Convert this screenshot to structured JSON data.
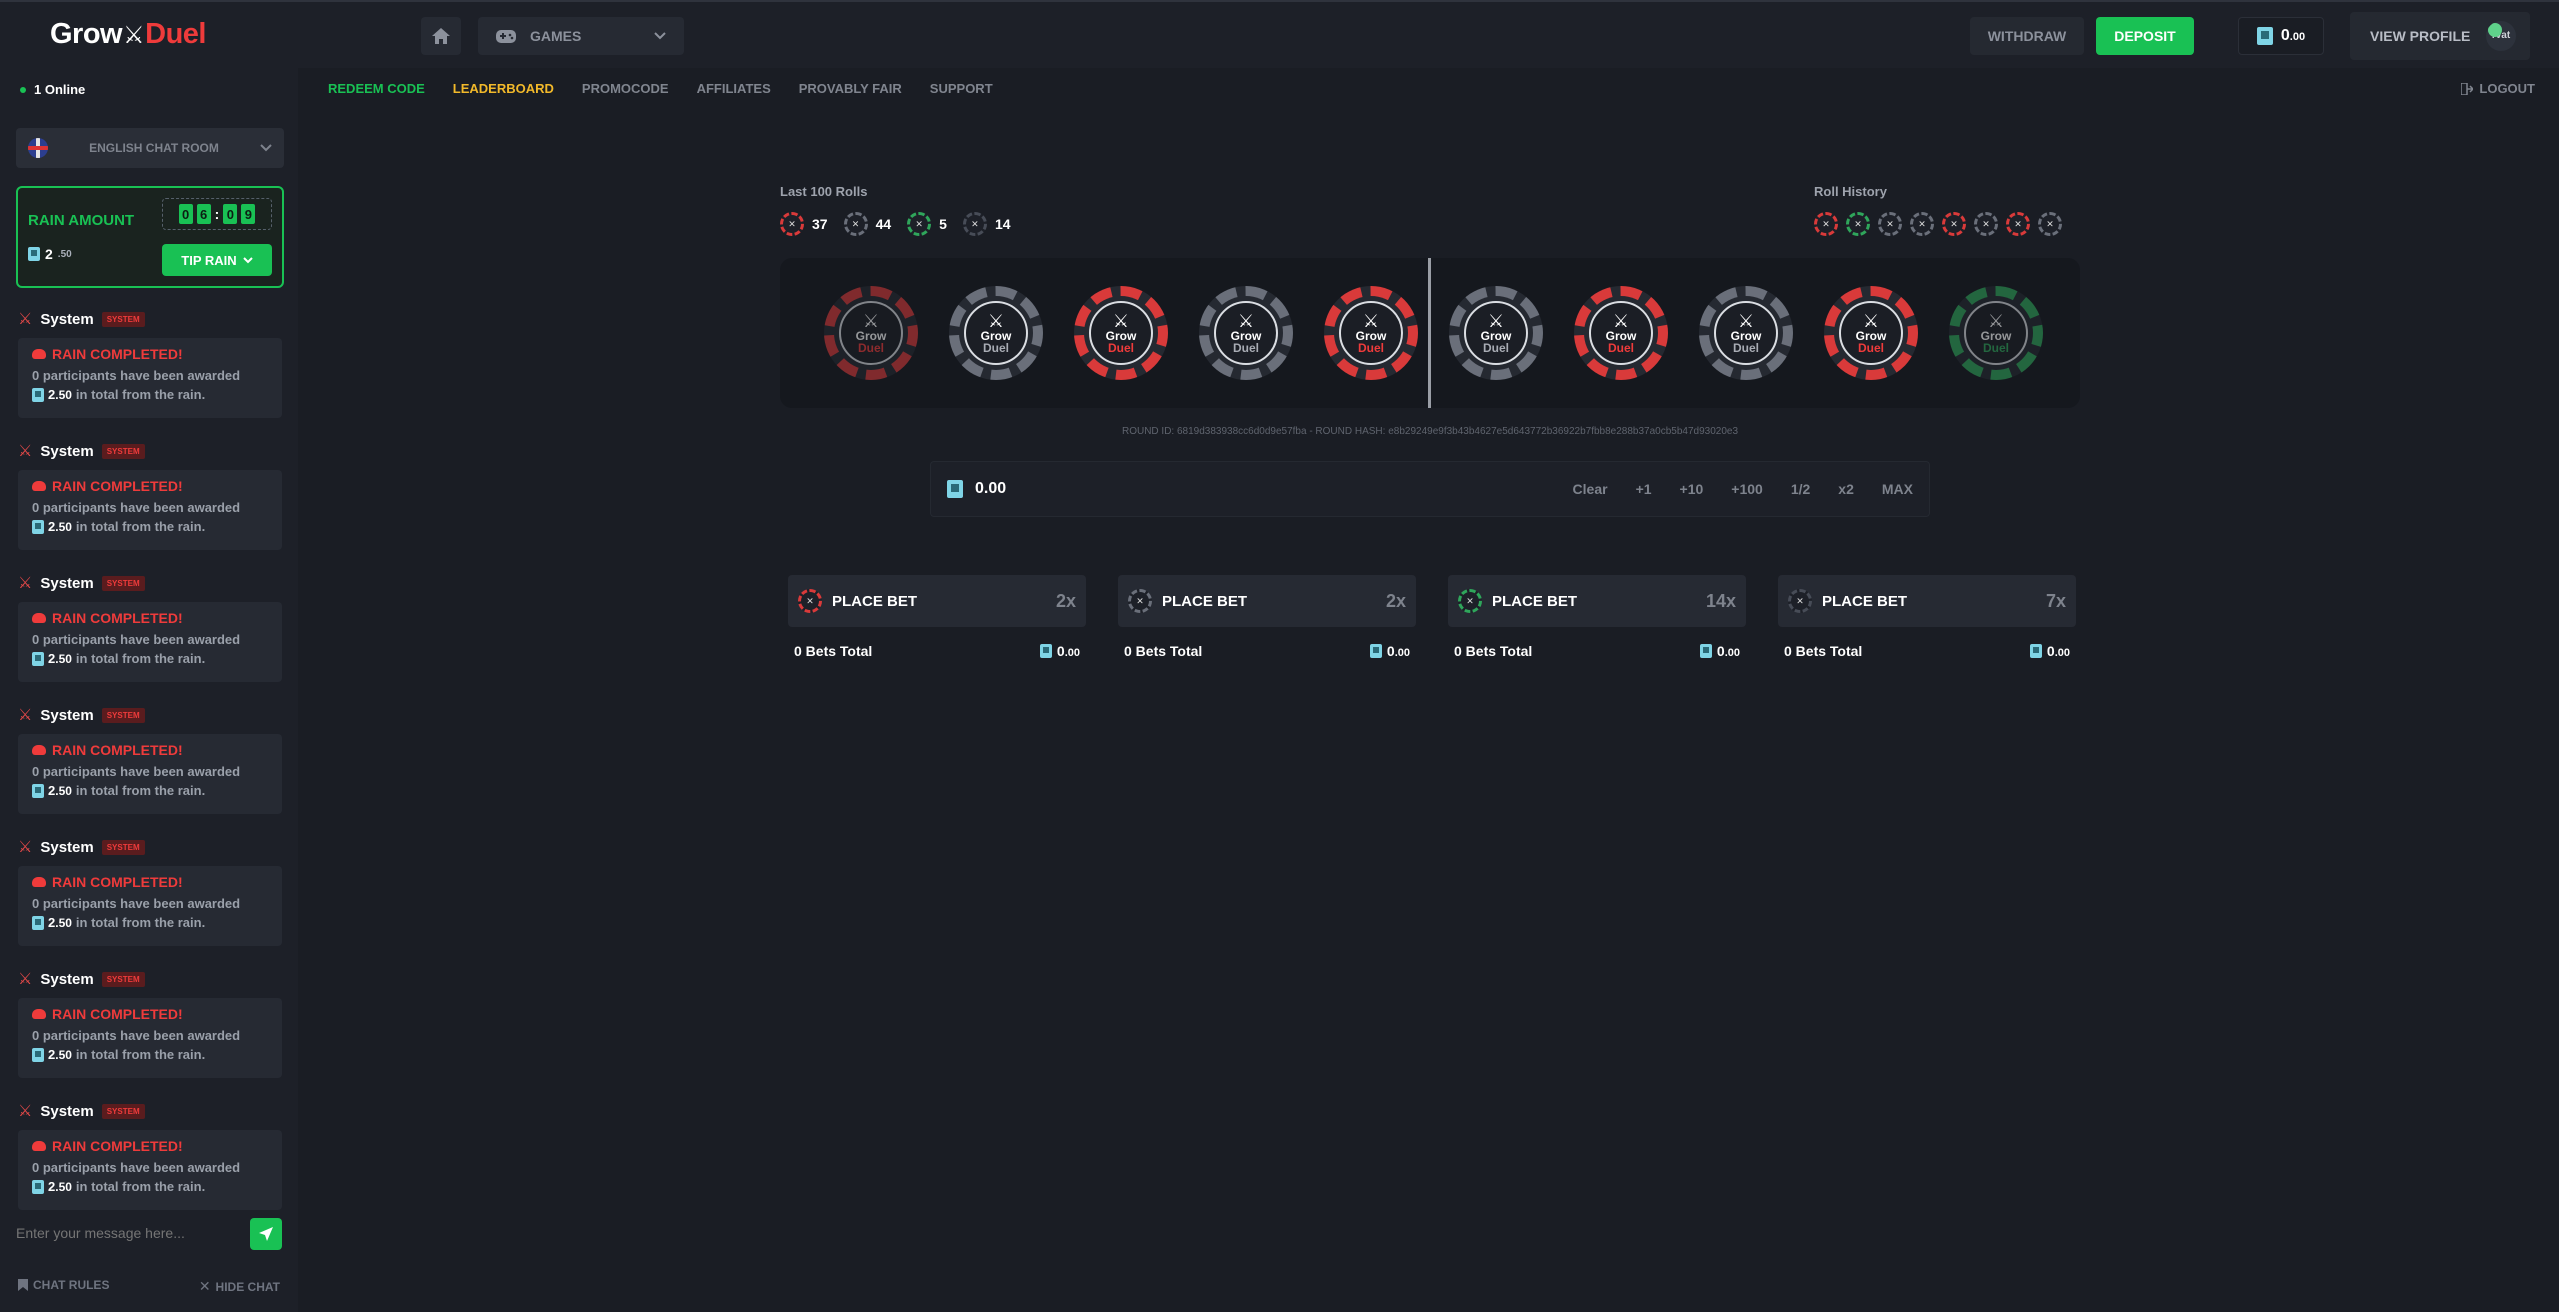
{
  "brand": {
    "logo_left": "Grow",
    "logo_right": "Duel"
  },
  "header": {
    "games_label": "GAMES",
    "withdraw_label": "WITHDRAW",
    "deposit_label": "DEPOSIT",
    "balance_int": "0",
    "balance_dec": ".00",
    "profile_label": "VIEW PROFILE",
    "avatar_alt": "rvat"
  },
  "online": {
    "text": "1 Online"
  },
  "nav": {
    "items": [
      "REDEEM CODE",
      "LEADERBOARD",
      "PROMOCODE",
      "AFFILIATES",
      "PROVABLY FAIR",
      "SUPPORT"
    ],
    "logout_label": "LOGOUT"
  },
  "chat": {
    "room_label": "ENGLISH CHAT ROOM",
    "rain": {
      "title": "RAIN AMOUNT",
      "amount_int": "2",
      "amount_dec": ".50",
      "timer_digits": [
        "0",
        "6",
        "0",
        "9"
      ],
      "tip_label": "TIP RAIN"
    },
    "messages": [
      {
        "name": "System",
        "badge": "SYSTEM",
        "title": "RAIN COMPLETED!",
        "count": "0",
        "line1_rest": "participants have been awarded",
        "amount_int": "2",
        "amount_dec": ".50",
        "line2_rest": "in total from the rain."
      },
      {
        "name": "System",
        "badge": "SYSTEM",
        "title": "RAIN COMPLETED!",
        "count": "0",
        "line1_rest": "participants have been awarded",
        "amount_int": "2",
        "amount_dec": ".50",
        "line2_rest": "in total from the rain."
      },
      {
        "name": "System",
        "badge": "SYSTEM",
        "title": "RAIN COMPLETED!",
        "count": "0",
        "line1_rest": "participants have been awarded",
        "amount_int": "2",
        "amount_dec": ".50",
        "line2_rest": "in total from the rain."
      },
      {
        "name": "System",
        "badge": "SYSTEM",
        "title": "RAIN COMPLETED!",
        "count": "0",
        "line1_rest": "participants have been awarded",
        "amount_int": "2",
        "amount_dec": ".50",
        "line2_rest": "in total from the rain."
      },
      {
        "name": "System",
        "badge": "SYSTEM",
        "title": "RAIN COMPLETED!",
        "count": "0",
        "line1_rest": "participants have been awarded",
        "amount_int": "2",
        "amount_dec": ".50",
        "line2_rest": "in total from the rain."
      },
      {
        "name": "System",
        "badge": "SYSTEM",
        "title": "RAIN COMPLETED!",
        "count": "0",
        "line1_rest": "participants have been awarded",
        "amount_int": "2",
        "amount_dec": ".50",
        "line2_rest": "in total from the rain."
      },
      {
        "name": "System",
        "badge": "SYSTEM",
        "title": "RAIN COMPLETED!",
        "count": "0",
        "line1_rest": "participants have been awarded",
        "amount_int": "2",
        "amount_dec": ".50",
        "line2_rest": "in total from the rain."
      }
    ],
    "input_placeholder": "Enter your message here...",
    "rules_label": "CHAT RULES",
    "hide_label": "HIDE CHAT"
  },
  "game": {
    "last_rolls_label": "Last 100 Rolls",
    "last_rolls": [
      {
        "color": "red",
        "count": "37"
      },
      {
        "color": "grey",
        "count": "44"
      },
      {
        "color": "green",
        "count": "5"
      },
      {
        "color": "dark",
        "count": "14"
      }
    ],
    "history_label": "Roll History",
    "history": [
      "red",
      "green",
      "grey",
      "grey",
      "red",
      "grey",
      "red",
      "grey"
    ],
    "roller_chips": [
      {
        "color": "red",
        "word1": "Grow",
        "word2": "Duel",
        "faded": true
      },
      {
        "color": "grey",
        "word1": "Grow",
        "word2": "Duel",
        "faded": false
      },
      {
        "color": "red",
        "word1": "Grow",
        "word2": "Duel",
        "faded": false
      },
      {
        "color": "grey",
        "word1": "Grow",
        "word2": "Duel",
        "faded": false
      },
      {
        "color": "red",
        "word1": "Grow",
        "word2": "Duel",
        "faded": false
      },
      {
        "color": "grey",
        "word1": "Grow",
        "word2": "Duel",
        "faded": false
      },
      {
        "color": "red",
        "word1": "Grow",
        "word2": "Duel",
        "faded": false
      },
      {
        "color": "grey",
        "word1": "Grow",
        "word2": "Duel",
        "faded": false
      },
      {
        "color": "red",
        "word1": "Grow",
        "word2": "Duel",
        "faded": false
      },
      {
        "color": "green",
        "word1": "Grow",
        "word2": "Duel",
        "faded": true
      }
    ],
    "round_info": "ROUND ID: 6819d383938cc6d0d9e57fba - ROUND HASH: e8b29249e9f3b43b4627e5d643772b36922b7fbb8e288b37a0cb5b47d93020e3",
    "bet_amount": "0.00",
    "bet_options": [
      "Clear",
      "+1",
      "+10",
      "+100",
      "1/2",
      "x2",
      "MAX"
    ],
    "bet_panels": [
      {
        "color": "red",
        "label": "PLACE BET",
        "multiplier": "2x",
        "bets_total": "0 Bets Total",
        "amount_int": "0",
        "amount_dec": ".00"
      },
      {
        "color": "grey",
        "label": "PLACE BET",
        "multiplier": "2x",
        "bets_total": "0 Bets Total",
        "amount_int": "0",
        "amount_dec": ".00"
      },
      {
        "color": "green",
        "label": "PLACE BET",
        "multiplier": "14x",
        "bets_total": "0 Bets Total",
        "amount_int": "0",
        "amount_dec": ".00"
      },
      {
        "color": "dark",
        "label": "PLACE BET",
        "multiplier": "7x",
        "bets_total": "0 Bets Total",
        "amount_int": "0",
        "amount_dec": ".00"
      }
    ]
  }
}
